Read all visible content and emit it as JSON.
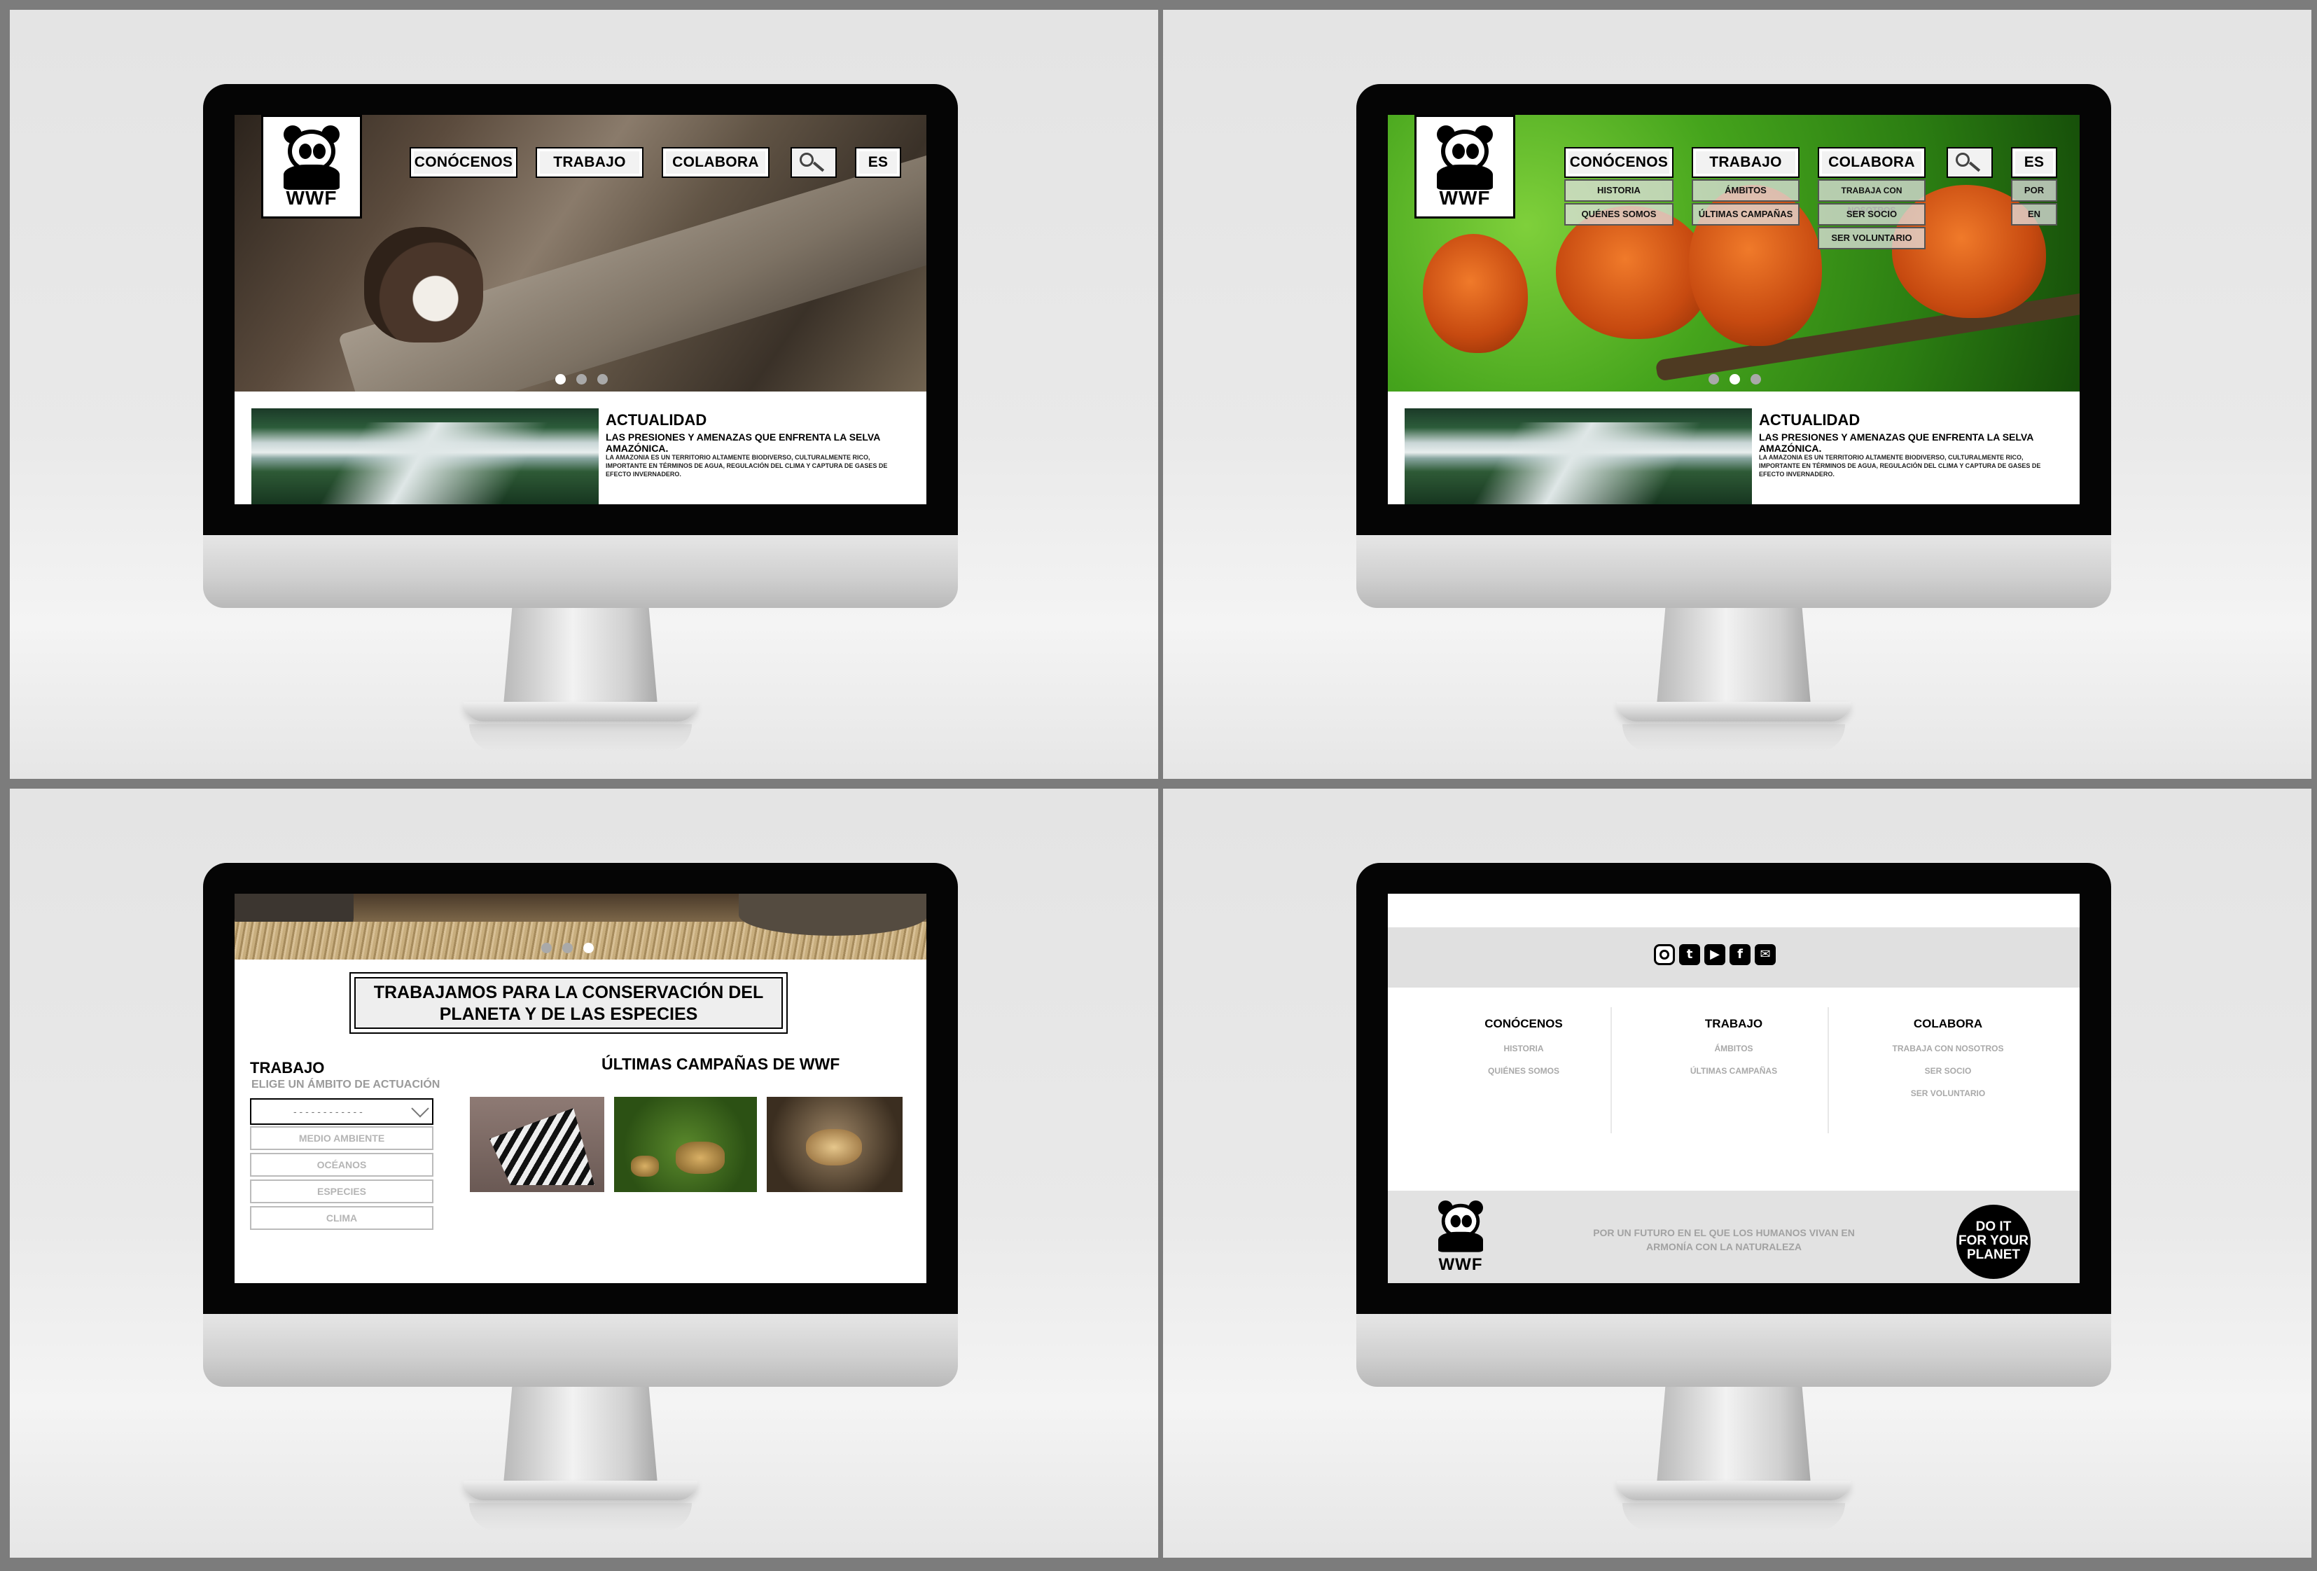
{
  "brand": {
    "name": "WWF"
  },
  "nav": {
    "conocenos": "CONÓCENOS",
    "trabajo": "TRABAJO",
    "colabora": "COLABORA",
    "lang": "ES",
    "search_icon": "search-icon"
  },
  "submenus": {
    "conocenos": [
      "HISTORIA",
      "QUÉNES SOMOS"
    ],
    "trabajo": [
      "ÁMBITOS",
      "ÚLTIMAS CAMPAÑAS"
    ],
    "colabora": [
      "TRABAJA CON NOSOTROS",
      "SER SOCIO",
      "SER VOLUNTARIO"
    ],
    "lang": [
      "POR",
      "EN"
    ]
  },
  "news": {
    "heading": "ACTUALIDAD",
    "subheading": "LAS PRESIONES Y AMENAZAS QUE ENFRENTA LA SELVA AMAZÓNICA.",
    "body": "LA AMAZONIA ES UN TERRITORIO ALTAMENTE BIODIVERSO, CULTURALMENTE RICO, IMPORTANTE EN TÉRMINOS DE AGUA, REGULACIÓN DEL CLIMA Y CAPTURA DE GASES DE EFECTO INVERNADERO."
  },
  "carousel": {
    "count": 3,
    "active_screen1": 1,
    "active_screen2": 2,
    "active_screen3": 3
  },
  "mission": {
    "line1": "TRABAJAMOS PARA LA CONSERVACIÓN DEL",
    "line2": "PLANETA Y DE LAS ESPECIES"
  },
  "trabajo_panel": {
    "heading": "TRABAJO",
    "subheading": "ELIGE UN ÁMBITO DE ACTUACIÓN",
    "select_value": "- - - - - - - - - - - -",
    "options": [
      "MEDIO AMBIENTE",
      "OCÉANOS",
      "ESPECIES",
      "CLIMA"
    ]
  },
  "campaigns": {
    "heading": "ÚLTIMAS CAMPAÑAS DE WWF"
  },
  "social_icons": [
    "instagram-icon",
    "twitter-icon",
    "youtube-icon",
    "facebook-icon",
    "mail-icon"
  ],
  "footer": {
    "col1": {
      "title": "CONÓCENOS",
      "links": [
        "HISTORIA",
        "QUIÉNES SOMOS"
      ]
    },
    "col2": {
      "title": "TRABAJO",
      "links": [
        "ÁMBITOS",
        "ÚLTIMAS CAMPAÑAS"
      ]
    },
    "col3": {
      "title": "COLABORA",
      "links": [
        "TRABAJA CON NOSOTROS",
        "SER SOCIO",
        "SER VOLUNTARIO"
      ]
    },
    "slogan": "POR UN FUTURO EN EL QUE LOS HUMANOS VIVAN EN ARMONÍA CON LA NATURALEZA",
    "badge": [
      "DO IT",
      "FOR YOUR",
      "PLANET"
    ]
  }
}
